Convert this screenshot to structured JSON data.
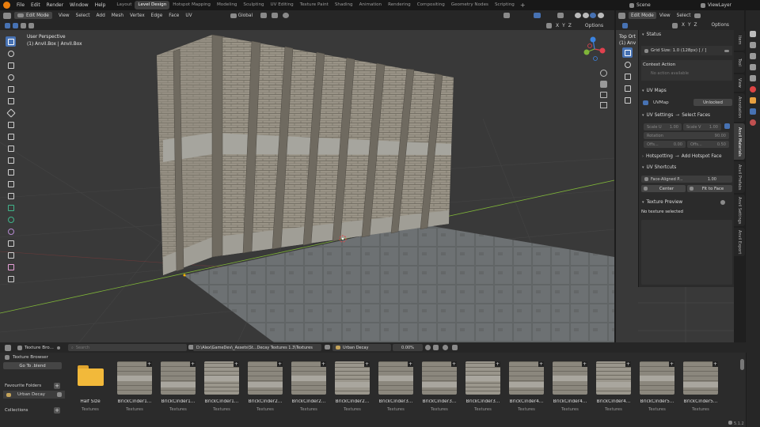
{
  "menu": [
    "File",
    "Edit",
    "Render",
    "Window",
    "Help"
  ],
  "workspaces": [
    "Layout",
    "Level Design",
    "Hotspot Mapping",
    "Modeling",
    "Sculpting",
    "UV Editing",
    "Texture Paint",
    "Shading",
    "Animation",
    "Rendering",
    "Compositing",
    "Geometry Nodes",
    "Scripting"
  ],
  "active_workspace": "Level Design",
  "scene": "Scene",
  "view_layer": "ViewLayer",
  "viewport": {
    "mode": "Edit Mode",
    "menus": [
      "View",
      "Select",
      "Add",
      "Mesh",
      "Vertex",
      "Edge",
      "Face",
      "UV"
    ],
    "orientation": "Global",
    "overlay_line1": "User Perspective",
    "overlay_line2": "(1) Anvil.Box | Anvil.Box",
    "xyz": [
      "X",
      "Y",
      "Z"
    ],
    "options": "Options"
  },
  "right_view": {
    "mode": "Edit Mode",
    "menus": [
      "View",
      "Select"
    ],
    "overlay_line1": "Top Ort",
    "overlay_line2": "(1) Anv",
    "xyz": [
      "X",
      "Y",
      "Z"
    ],
    "options": "Options"
  },
  "sidebar": {
    "tabs": [
      "Item",
      "Tool",
      "View",
      "Annotation",
      "Anvil Materials",
      "Anvil Prefabs",
      "Anvil Settings",
      "Anvil Export"
    ],
    "status_title": "Status",
    "grid_size": "Grid Size: 1.0  (128px)  [ / ]",
    "context_action": "Context Action",
    "no_action": "No action available",
    "uv_maps_title": "UV Maps",
    "uvmap": "UVMap",
    "unlocked": "Unlocked",
    "uv_settings_title": "UV Settings",
    "select_faces": "Select Faces",
    "scale_u_label": "Scale U",
    "scale_u": "1.00",
    "scale_v_label": "Scale V",
    "scale_v": "1.00",
    "rotation_label": "Rotation",
    "rotation": "90.00",
    "offset_u_label": "Offs...",
    "offset_u": "0.00",
    "offset_v_label": "Offs...",
    "offset_v": "0.50",
    "hotspotting_title": "Hotspotting",
    "add_hotspot_face": "Add Hotspot Face",
    "uv_shortcuts_title": "UV Shortcuts",
    "face_aligned": "Face-Aligned P...",
    "face_aligned_val": "1.00",
    "center": "Center",
    "fit_to_face": "Fit to Face",
    "texture_preview_title": "Texture Preview",
    "no_texture": "No texture selected"
  },
  "browser": {
    "title": "Texture Bro...",
    "search_placeholder": "Search",
    "path": "D:\\Alex\\GameDev\\_Assets\\St...Decay Textures 1.3\\Textures",
    "folder": "Urban Decay",
    "progress": "0.00%",
    "sidebar_title": "Texture Browser",
    "go_to_blend": "Go To .blend",
    "favourite_folders": "Favourite Folders",
    "fav_item": "Urban Decay",
    "collections": "Collections",
    "items": [
      {
        "name": "Half Size",
        "sub": "Textures"
      },
      {
        "name": "BrickCinder1...",
        "sub": "Textures"
      },
      {
        "name": "BrickCinder1...",
        "sub": "Textures"
      },
      {
        "name": "BrickCinder1...",
        "sub": "Textures"
      },
      {
        "name": "BrickCinder2...",
        "sub": "Textures"
      },
      {
        "name": "BrickCinder2...",
        "sub": "Textures"
      },
      {
        "name": "BrickCinder2...",
        "sub": "Textures"
      },
      {
        "name": "BrickCinder3...",
        "sub": "Textures"
      },
      {
        "name": "BrickCinder3...",
        "sub": "Textures"
      },
      {
        "name": "BrickCinder3...",
        "sub": "Textures"
      },
      {
        "name": "BrickCinder4...",
        "sub": "Textures"
      },
      {
        "name": "BrickCinder4...",
        "sub": "Textures"
      },
      {
        "name": "BrickCinder4...",
        "sub": "Textures"
      },
      {
        "name": "BrickCinder5...",
        "sub": "Textures"
      },
      {
        "name": "BrickCinder5...",
        "sub": "Textures"
      }
    ]
  },
  "version": "5.1.2",
  "colors": {
    "accent": "#4772b3",
    "x_axis": "#e0414e",
    "y_axis": "#7fb539",
    "z_axis": "#3b83e0",
    "active_ws": "#3f3f3f"
  }
}
